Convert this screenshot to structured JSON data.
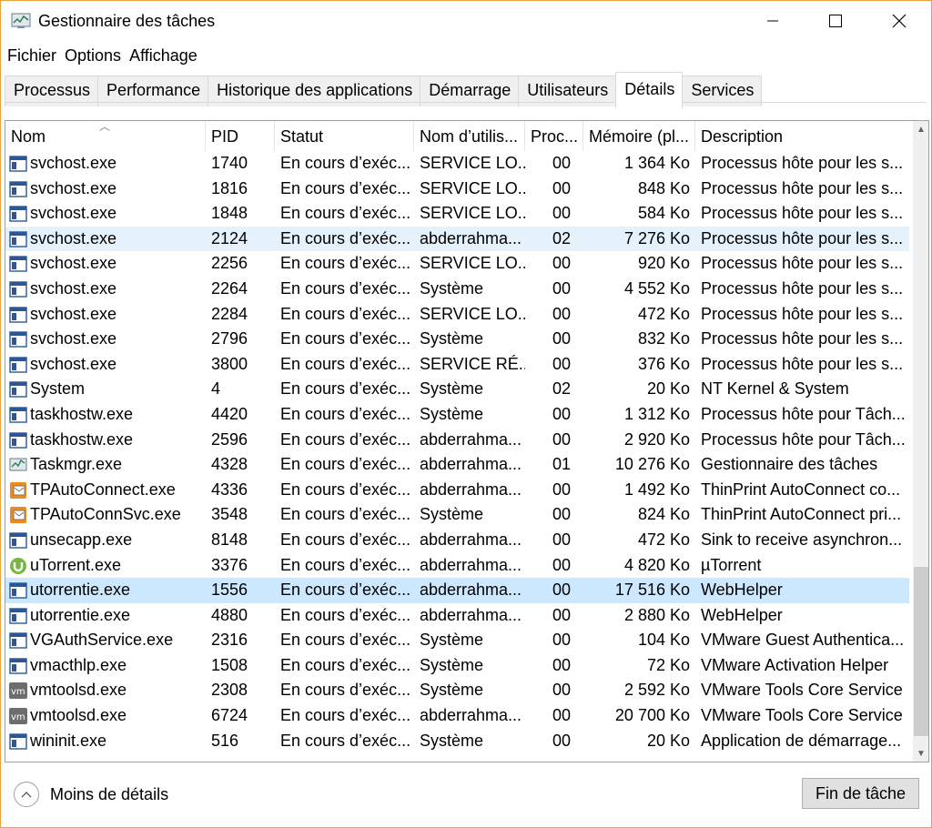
{
  "window": {
    "title": "Gestionnaire des tâches",
    "accent_color": "#e8a23a"
  },
  "menu": [
    "Fichier",
    "Options",
    "Affichage"
  ],
  "tabs": [
    {
      "label": "Processus",
      "active": false
    },
    {
      "label": "Performance",
      "active": false
    },
    {
      "label": "Historique des applications",
      "active": false
    },
    {
      "label": "Démarrage",
      "active": false
    },
    {
      "label": "Utilisateurs",
      "active": false
    },
    {
      "label": "Détails",
      "active": true
    },
    {
      "label": "Services",
      "active": false
    }
  ],
  "table": {
    "columns": [
      "Nom",
      "PID",
      "Statut",
      "Nom d’utilis...",
      "Proc...",
      "Mémoire (pl...",
      "Description"
    ],
    "rows": [
      {
        "name": "svchost.exe",
        "icon": "service-host-icon",
        "pid": "1740",
        "status": "En cours d’exéc...",
        "user": "SERVICE LO...",
        "cpu": "00",
        "mem": "1 364 Ko",
        "desc": "Processus hôte pour les s...",
        "state": ""
      },
      {
        "name": "svchost.exe",
        "icon": "service-host-icon",
        "pid": "1816",
        "status": "En cours d’exéc...",
        "user": "SERVICE LO...",
        "cpu": "00",
        "mem": "848 Ko",
        "desc": "Processus hôte pour les s...",
        "state": ""
      },
      {
        "name": "svchost.exe",
        "icon": "service-host-icon",
        "pid": "1848",
        "status": "En cours d’exéc...",
        "user": "SERVICE LO...",
        "cpu": "00",
        "mem": "584 Ko",
        "desc": "Processus hôte pour les s...",
        "state": ""
      },
      {
        "name": "svchost.exe",
        "icon": "service-host-icon",
        "pid": "2124",
        "status": "En cours d’exéc...",
        "user": "abderrahma...",
        "cpu": "02",
        "mem": "7 276 Ko",
        "desc": "Processus hôte pour les s...",
        "state": "hover"
      },
      {
        "name": "svchost.exe",
        "icon": "service-host-icon",
        "pid": "2256",
        "status": "En cours d’exéc...",
        "user": "SERVICE LO...",
        "cpu": "00",
        "mem": "920 Ko",
        "desc": "Processus hôte pour les s...",
        "state": ""
      },
      {
        "name": "svchost.exe",
        "icon": "service-host-icon",
        "pid": "2264",
        "status": "En cours d’exéc...",
        "user": "Système",
        "cpu": "00",
        "mem": "4 552 Ko",
        "desc": "Processus hôte pour les s...",
        "state": ""
      },
      {
        "name": "svchost.exe",
        "icon": "service-host-icon",
        "pid": "2284",
        "status": "En cours d’exéc...",
        "user": "SERVICE LO...",
        "cpu": "00",
        "mem": "472 Ko",
        "desc": "Processus hôte pour les s...",
        "state": ""
      },
      {
        "name": "svchost.exe",
        "icon": "service-host-icon",
        "pid": "2796",
        "status": "En cours d’exéc...",
        "user": "Système",
        "cpu": "00",
        "mem": "832 Ko",
        "desc": "Processus hôte pour les s...",
        "state": ""
      },
      {
        "name": "svchost.exe",
        "icon": "service-host-icon",
        "pid": "3800",
        "status": "En cours d’exéc...",
        "user": "SERVICE RÉ...",
        "cpu": "00",
        "mem": "376 Ko",
        "desc": "Processus hôte pour les s...",
        "state": ""
      },
      {
        "name": "System",
        "icon": "service-host-icon",
        "pid": "4",
        "status": "En cours d’exéc...",
        "user": "Système",
        "cpu": "02",
        "mem": "20 Ko",
        "desc": "NT Kernel & System",
        "state": ""
      },
      {
        "name": "taskhostw.exe",
        "icon": "service-host-icon",
        "pid": "4420",
        "status": "En cours d’exéc...",
        "user": "Système",
        "cpu": "00",
        "mem": "1 312 Ko",
        "desc": "Processus hôte pour Tâch...",
        "state": ""
      },
      {
        "name": "taskhostw.exe",
        "icon": "service-host-icon",
        "pid": "2596",
        "status": "En cours d’exéc...",
        "user": "abderrahma...",
        "cpu": "00",
        "mem": "2 920 Ko",
        "desc": "Processus hôte pour Tâch...",
        "state": ""
      },
      {
        "name": "Taskmgr.exe",
        "icon": "task-manager-icon",
        "pid": "4328",
        "status": "En cours d’exéc...",
        "user": "abderrahma...",
        "cpu": "01",
        "mem": "10 276 Ko",
        "desc": "Gestionnaire des tâches",
        "state": ""
      },
      {
        "name": "TPAutoConnect.exe",
        "icon": "thinprint-icon",
        "pid": "4336",
        "status": "En cours d’exéc...",
        "user": "abderrahma...",
        "cpu": "00",
        "mem": "1 492 Ko",
        "desc": "ThinPrint AutoConnect co...",
        "state": ""
      },
      {
        "name": "TPAutoConnSvc.exe",
        "icon": "thinprint-icon",
        "pid": "3548",
        "status": "En cours d’exéc...",
        "user": "Système",
        "cpu": "00",
        "mem": "824 Ko",
        "desc": "ThinPrint AutoConnect pri...",
        "state": ""
      },
      {
        "name": "unsecapp.exe",
        "icon": "service-host-icon",
        "pid": "8148",
        "status": "En cours d’exéc...",
        "user": "abderrahma...",
        "cpu": "00",
        "mem": "472 Ko",
        "desc": "Sink to receive asynchron...",
        "state": ""
      },
      {
        "name": "uTorrent.exe",
        "icon": "utorrent-icon",
        "pid": "3376",
        "status": "En cours d’exéc...",
        "user": "abderrahma...",
        "cpu": "00",
        "mem": "4 820 Ko",
        "desc": "µTorrent",
        "state": ""
      },
      {
        "name": "utorrentie.exe",
        "icon": "service-host-icon",
        "pid": "1556",
        "status": "En cours d’exéc...",
        "user": "abderrahma...",
        "cpu": "00",
        "mem": "17 516 Ko",
        "desc": "WebHelper",
        "state": "selected"
      },
      {
        "name": "utorrentie.exe",
        "icon": "service-host-icon",
        "pid": "4880",
        "status": "En cours d’exéc...",
        "user": "abderrahma...",
        "cpu": "00",
        "mem": "2 880 Ko",
        "desc": "WebHelper",
        "state": ""
      },
      {
        "name": "VGAuthService.exe",
        "icon": "service-host-icon",
        "pid": "2316",
        "status": "En cours d’exéc...",
        "user": "Système",
        "cpu": "00",
        "mem": "104 Ko",
        "desc": "VMware Guest Authentica...",
        "state": ""
      },
      {
        "name": "vmacthlp.exe",
        "icon": "service-host-icon",
        "pid": "1508",
        "status": "En cours d’exéc...",
        "user": "Système",
        "cpu": "00",
        "mem": "72 Ko",
        "desc": "VMware Activation Helper",
        "state": ""
      },
      {
        "name": "vmtoolsd.exe",
        "icon": "vmware-icon",
        "pid": "2308",
        "status": "En cours d’exéc...",
        "user": "Système",
        "cpu": "00",
        "mem": "2 592 Ko",
        "desc": "VMware Tools Core Service",
        "state": ""
      },
      {
        "name": "vmtoolsd.exe",
        "icon": "vmware-icon",
        "pid": "6724",
        "status": "En cours d’exéc...",
        "user": "abderrahma...",
        "cpu": "00",
        "mem": "20 700 Ko",
        "desc": "VMware Tools Core Service",
        "state": ""
      },
      {
        "name": "wininit.exe",
        "icon": "service-host-icon",
        "pid": "516",
        "status": "En cours d’exéc...",
        "user": "Système",
        "cpu": "00",
        "mem": "20 Ko",
        "desc": "Application de démarrage...",
        "state": ""
      }
    ]
  },
  "footer": {
    "less_details": "Moins de détails",
    "end_task": "Fin de tâche"
  }
}
